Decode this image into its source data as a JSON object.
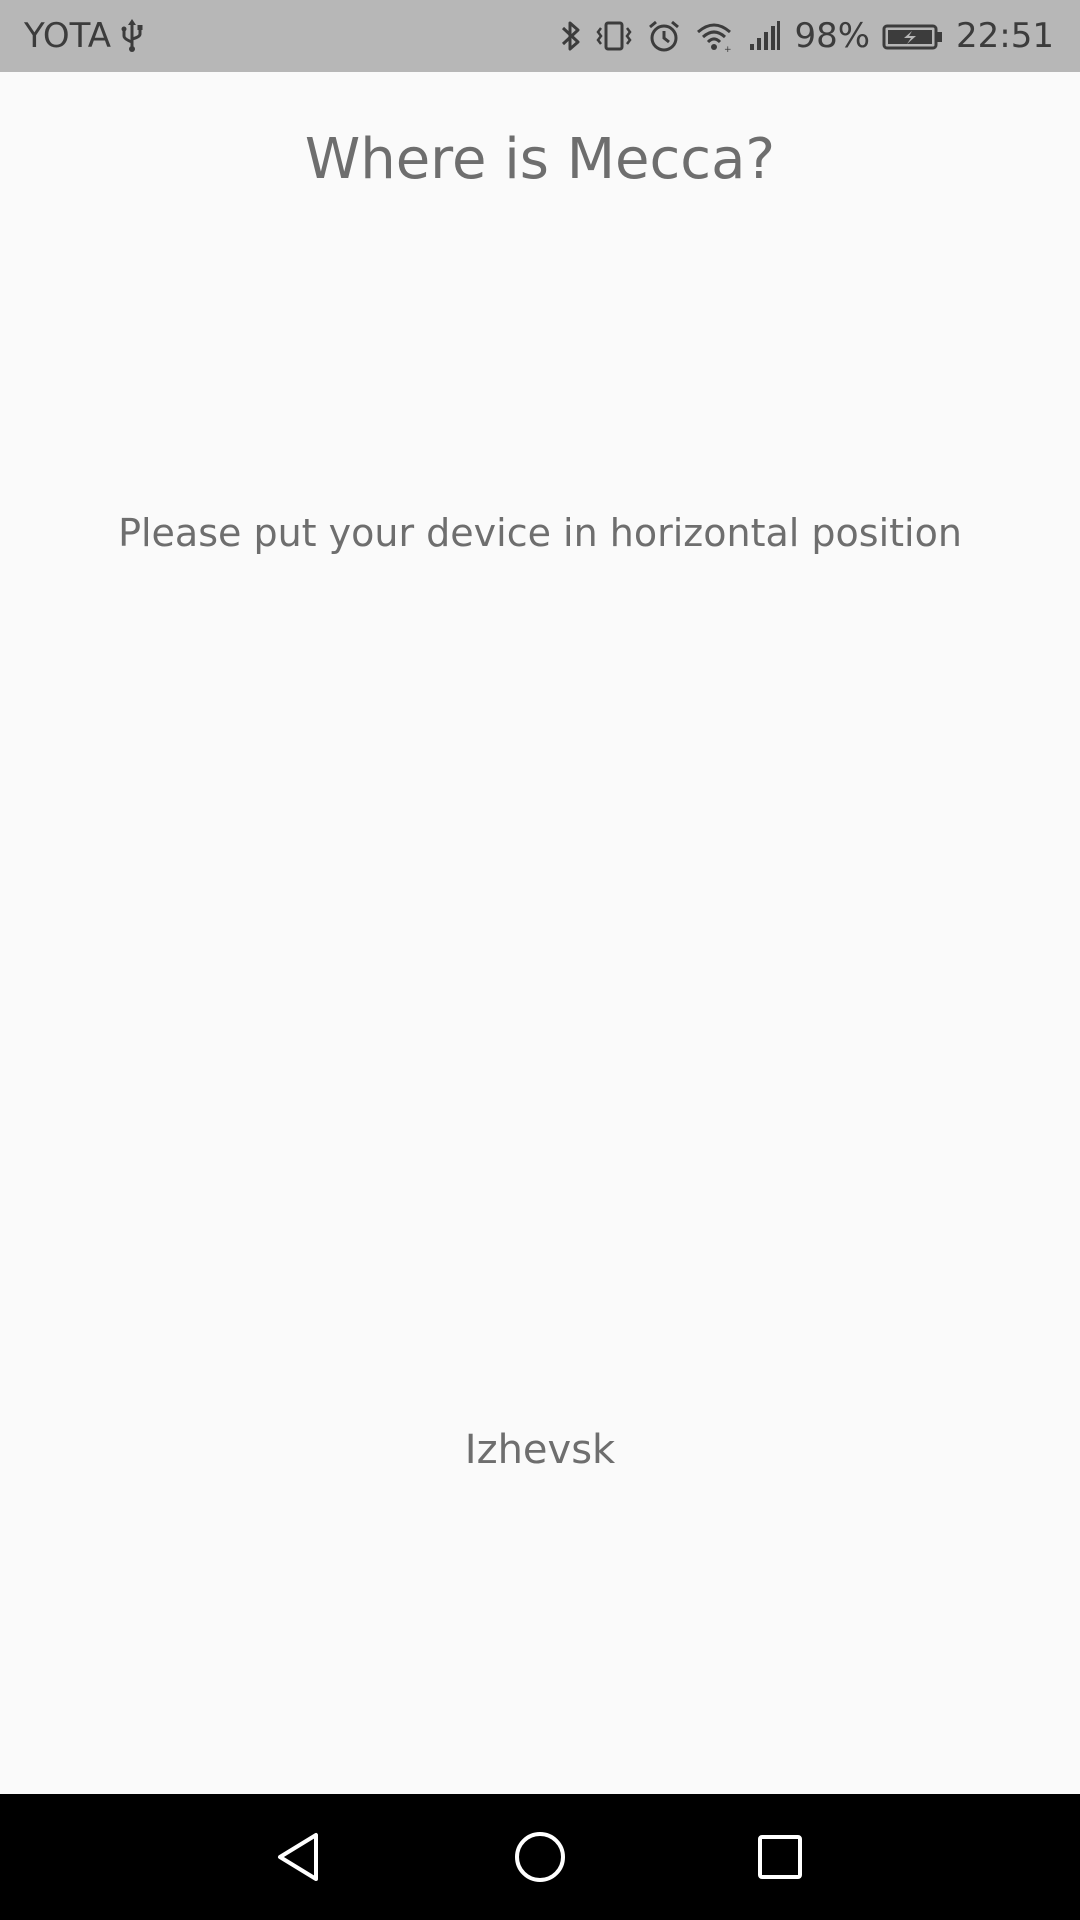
{
  "status_bar": {
    "carrier": "YOTA",
    "battery_percent": "98%",
    "time": "22:51",
    "icons": [
      "usb-icon",
      "bluetooth-icon",
      "vibrate-icon",
      "alarm-icon",
      "wifi-icon",
      "signal-icon",
      "battery-charging-icon"
    ]
  },
  "main": {
    "title": "Where is Mecca?",
    "hint": "Please put your device in horizontal position",
    "city": "Izhevsk"
  },
  "nav_bar": {
    "buttons": [
      "back-icon",
      "home-icon",
      "recents-icon"
    ]
  },
  "colors": {
    "status_bar_bg": "#b7b7b7",
    "background": "#fafafa",
    "text": "#6e6e6e",
    "nav_bar_bg": "#000000"
  }
}
